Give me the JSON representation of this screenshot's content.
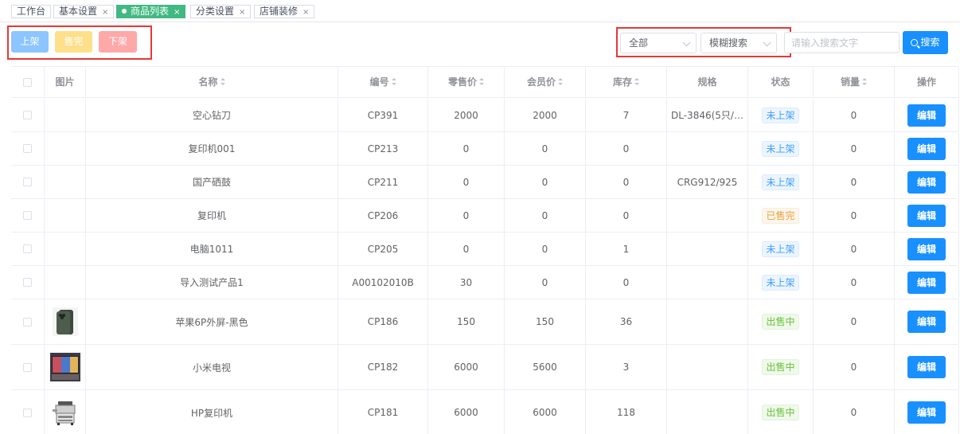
{
  "tabs": [
    {
      "label": "工作台",
      "closable": false,
      "active": false
    },
    {
      "label": "基本设置",
      "closable": true,
      "active": false
    },
    {
      "label": "商品列表",
      "closable": true,
      "active": true
    },
    {
      "label": "分类设置",
      "closable": true,
      "active": false
    },
    {
      "label": "店铺装修",
      "closable": true,
      "active": false
    }
  ],
  "toolbar": {
    "on_shelf_label": "上架",
    "sold_out_label": "售完",
    "off_shelf_label": "下架",
    "status_select_value": "全部",
    "mode_select_value": "模糊搜索",
    "search_placeholder": "请输入搜索文字",
    "search_label": "搜索",
    "colors": {
      "on_shelf": "#8cc5ff",
      "sold_out": "#ffe08a",
      "off_shelf": "#ffa8a8",
      "primary": "#1890ff",
      "highlight_box": "#e53935"
    }
  },
  "table": {
    "headers": {
      "image": "图片",
      "name": "名称",
      "code": "编号",
      "retail_price": "零售价",
      "member_price": "会员价",
      "stock": "库存",
      "spec": "规格",
      "status": "状态",
      "sales": "销量",
      "actions": "操作"
    },
    "edit_label": "编辑",
    "rows": [
      {
        "image": "",
        "name": "空心钻刀",
        "code": "CP391",
        "retail_price": "2000",
        "member_price": "2000",
        "stock": "7",
        "spec": "DL-3846(5只/…",
        "status": "未上架",
        "status_type": "blue",
        "sales": "0"
      },
      {
        "image": "",
        "name": "复印机001",
        "code": "CP213",
        "retail_price": "0",
        "member_price": "0",
        "stock": "0",
        "spec": "",
        "status": "未上架",
        "status_type": "blue",
        "sales": "0"
      },
      {
        "image": "",
        "name": "国产硒鼓",
        "code": "CP211",
        "retail_price": "0",
        "member_price": "0",
        "stock": "0",
        "spec": "CRG912/925",
        "status": "未上架",
        "status_type": "blue",
        "sales": "0"
      },
      {
        "image": "",
        "name": "复印机",
        "code": "CP206",
        "retail_price": "0",
        "member_price": "0",
        "stock": "0",
        "spec": "",
        "status": "已售完",
        "status_type": "yellow",
        "sales": "0"
      },
      {
        "image": "",
        "name": "电脑1011",
        "code": "CP205",
        "retail_price": "0",
        "member_price": "0",
        "stock": "1",
        "spec": "",
        "status": "未上架",
        "status_type": "blue",
        "sales": "0"
      },
      {
        "image": "",
        "name": "导入测试产品1",
        "code": "A00102010B",
        "retail_price": "30",
        "member_price": "0",
        "stock": "0",
        "spec": "",
        "status": "未上架",
        "status_type": "blue",
        "sales": "0"
      },
      {
        "image": "phone-photo",
        "name": "苹果6P外屏-黑色",
        "code": "CP186",
        "retail_price": "150",
        "member_price": "150",
        "stock": "36",
        "spec": "",
        "status": "出售中",
        "status_type": "green",
        "sales": "0"
      },
      {
        "image": "tv-photo",
        "name": "小米电视",
        "code": "CP182",
        "retail_price": "6000",
        "member_price": "5600",
        "stock": "3",
        "spec": "",
        "status": "出售中",
        "status_type": "green",
        "sales": "0"
      },
      {
        "image": "printer-photo",
        "name": "HP复印机",
        "code": "CP181",
        "retail_price": "6000",
        "member_price": "6000",
        "stock": "118",
        "spec": "",
        "status": "出售中",
        "status_type": "green",
        "sales": "0"
      }
    ]
  }
}
